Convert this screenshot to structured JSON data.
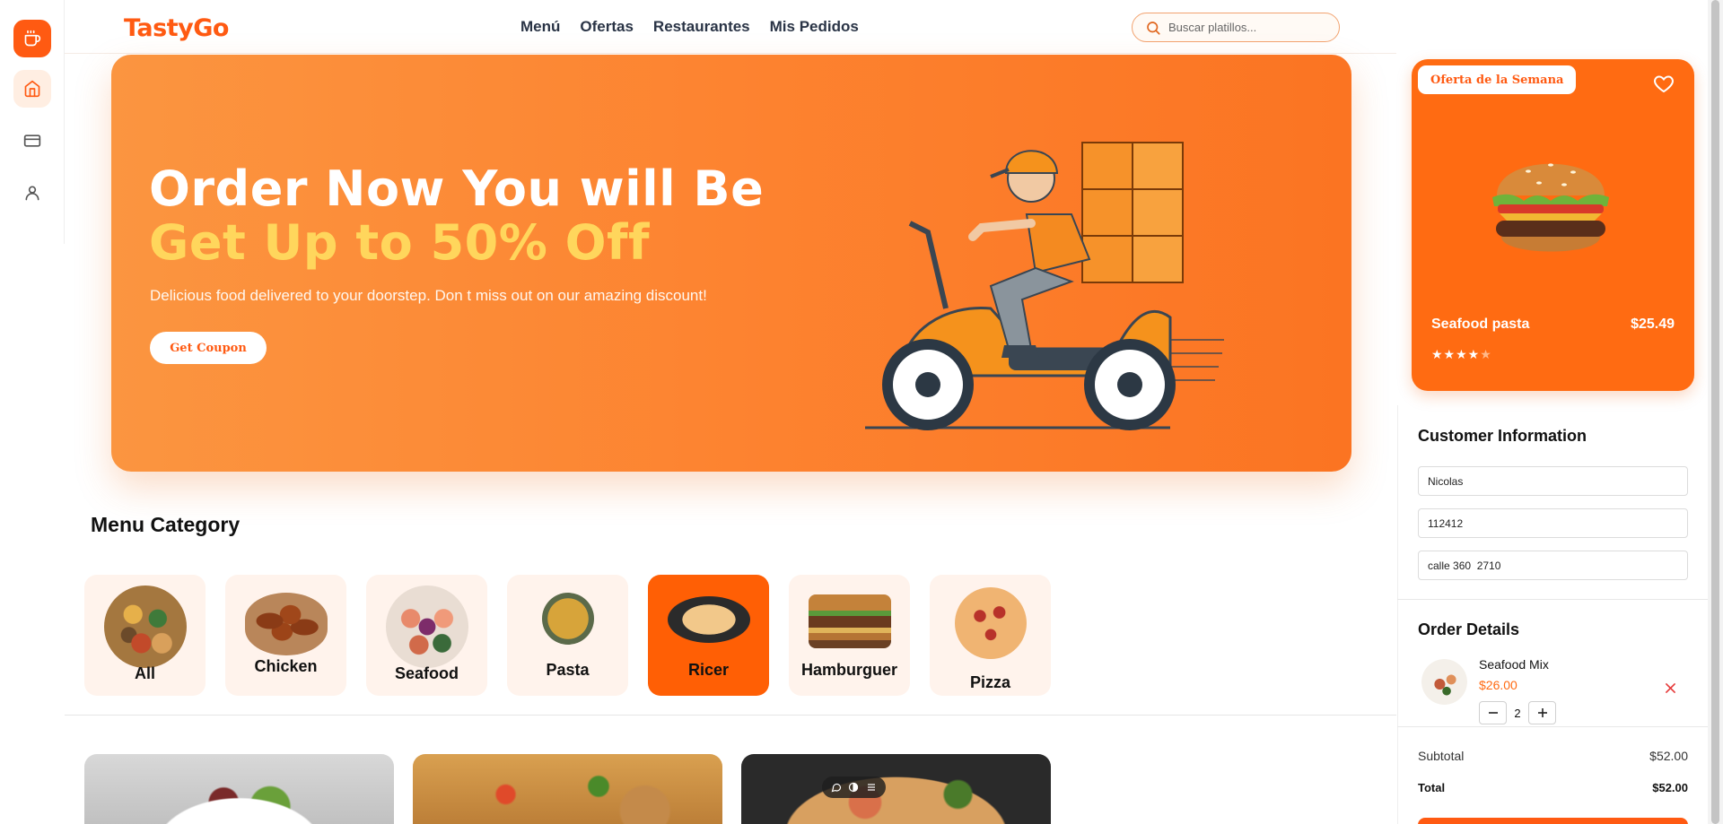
{
  "brand": "TastyGo",
  "nav": [
    "Menú",
    "Ofertas",
    "Restaurantes",
    "Mis Pedidos"
  ],
  "search": {
    "placeholder": "Buscar platillos..."
  },
  "hero": {
    "line1": "Order Now You will Be",
    "line2": "Get Up to 50% Off",
    "subtitle": "Delicious food delivered to your doorstep. Don t miss out on our amazing discount!",
    "button": "Get Coupon"
  },
  "menu_category": {
    "title": "Menu Category",
    "items": [
      {
        "label": "All",
        "active": false
      },
      {
        "label": "Chicken",
        "active": false
      },
      {
        "label": "Seafood",
        "active": false
      },
      {
        "label": "Pasta",
        "active": false
      },
      {
        "label": "Ricer",
        "active": true
      },
      {
        "label": "Hamburguer",
        "active": false
      },
      {
        "label": "Pizza",
        "active": false
      }
    ]
  },
  "offer": {
    "badge": "Oferta de la Semana",
    "name": "Seafood pasta",
    "price": "$25.49",
    "rating": 4,
    "rating_max": 5
  },
  "customer": {
    "title": "Customer Information",
    "name": "Nicolas",
    "phone": "112412",
    "address": "calle 360  2710"
  },
  "order": {
    "title": "Order Details",
    "items": [
      {
        "name": "Seafood Mix",
        "price": "$26.00",
        "qty": "2"
      }
    ],
    "subtotal_label": "Subtotal",
    "subtotal": "$52.00",
    "total_label": "Total",
    "total": "$52.00"
  },
  "colors": {
    "accent": "#ff5a12",
    "hero_highlight": "#ffd65c",
    "category_bg": "#fff3ec"
  },
  "icons": [
    "coffee-cup-icon",
    "home-icon",
    "card-icon",
    "user-icon",
    "search-icon",
    "heart-icon",
    "comment-icon",
    "toggle-icon",
    "list-icon"
  ]
}
